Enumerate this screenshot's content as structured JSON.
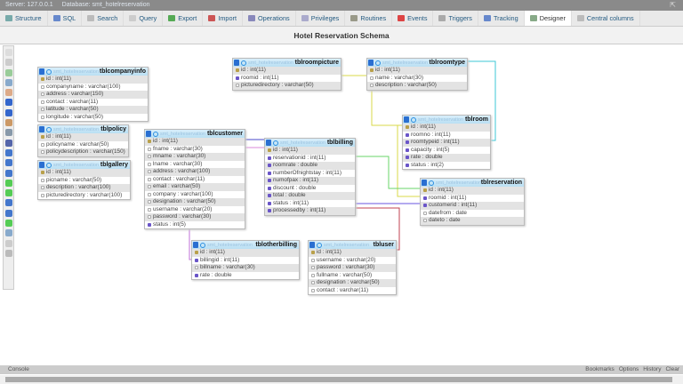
{
  "breadcrumb": {
    "server": "Server: 127.0.0.1",
    "database": "Database: smt_hotelreservation"
  },
  "tabs": [
    {
      "label": "Structure",
      "color": "#7aa"
    },
    {
      "label": "SQL",
      "color": "#68c"
    },
    {
      "label": "Search",
      "color": "#bbb"
    },
    {
      "label": "Query",
      "color": "#ccc"
    },
    {
      "label": "Export",
      "color": "#5a5"
    },
    {
      "label": "Import",
      "color": "#c55"
    },
    {
      "label": "Operations",
      "color": "#88b"
    },
    {
      "label": "Privileges",
      "color": "#aac"
    },
    {
      "label": "Routines",
      "color": "#998"
    },
    {
      "label": "Events",
      "color": "#d44"
    },
    {
      "label": "Triggers",
      "color": "#aaa"
    },
    {
      "label": "Tracking",
      "color": "#68c"
    },
    {
      "label": "Designer",
      "color": "#8a8",
      "active": true
    },
    {
      "label": "Central columns",
      "color": "#bbb"
    }
  ],
  "title": "Hotel Reservation Schema",
  "schema_prefix": "smt_hotelreservation",
  "tables": [
    {
      "name": "tblcompanyinfo",
      "fields": [
        [
          "pk",
          "id : int(11)"
        ],
        [
          "n",
          "companyname : varchar(100)"
        ],
        [
          "n",
          "address : varchar(150)"
        ],
        [
          "n",
          "contact : varchar(11)"
        ],
        [
          "n",
          "latitude : varchar(50)"
        ],
        [
          "n",
          "longitude : varchar(50)"
        ]
      ]
    },
    {
      "name": "tblpolicy",
      "fields": [
        [
          "pk",
          "id : int(11)"
        ],
        [
          "n",
          "policyname : varchar(50)"
        ],
        [
          "n",
          "policydescription : varchar(150)"
        ]
      ]
    },
    {
      "name": "tblgallery",
      "fields": [
        [
          "pk",
          "id : int(11)"
        ],
        [
          "n",
          "picname : varchar(50)"
        ],
        [
          "n",
          "description : varchar(100)"
        ],
        [
          "n",
          "picturedirectory : varchar(100)"
        ]
      ]
    },
    {
      "name": "tblcustomer",
      "fields": [
        [
          "pk",
          "id : int(11)"
        ],
        [
          "n",
          "fname : varchar(30)"
        ],
        [
          "n",
          "mname : varchar(30)"
        ],
        [
          "n",
          "lname : varchar(30)"
        ],
        [
          "n",
          "address : varchar(100)"
        ],
        [
          "n",
          "contact : varchar(11)"
        ],
        [
          "n",
          "email : varchar(50)"
        ],
        [
          "n",
          "company : varchar(100)"
        ],
        [
          "n",
          "designation : varchar(50)"
        ],
        [
          "n",
          "username : varchar(20)"
        ],
        [
          "n",
          "password : varchar(30)"
        ],
        [
          "fk",
          "status : int(5)"
        ]
      ]
    },
    {
      "name": "tblbilling",
      "fields": [
        [
          "pk",
          "id : int(11)"
        ],
        [
          "fk",
          "reservationid : int(11)"
        ],
        [
          "fk",
          "roomrate : double"
        ],
        [
          "fk",
          "numberOfnightstay : int(11)"
        ],
        [
          "fk",
          "numofpax : int(11)"
        ],
        [
          "fk",
          "discount : double"
        ],
        [
          "fk",
          "total : double"
        ],
        [
          "fk",
          "status : int(11)"
        ],
        [
          "fk",
          "processedby : int(11)"
        ]
      ]
    },
    {
      "name": "tblroompicture",
      "fields": [
        [
          "pk",
          "id : int(11)"
        ],
        [
          "fk",
          "roomid : int(11)"
        ],
        [
          "n",
          "picturedirectory : varchar(50)"
        ]
      ]
    },
    {
      "name": "tblroomtype",
      "fields": [
        [
          "pk",
          "id : int(11)"
        ],
        [
          "n",
          "name : varchar(30)"
        ],
        [
          "n",
          "description : varchar(50)"
        ]
      ]
    },
    {
      "name": "tblroom",
      "fields": [
        [
          "pk",
          "id : int(11)"
        ],
        [
          "fk",
          "roomno : int(11)"
        ],
        [
          "fk",
          "roomtypeid : int(11)"
        ],
        [
          "fk",
          "capacity : int(5)"
        ],
        [
          "fk",
          "rate : double"
        ],
        [
          "fk",
          "status : int(2)"
        ]
      ]
    },
    {
      "name": "tblreservation",
      "fields": [
        [
          "pk",
          "id : int(11)"
        ],
        [
          "fk",
          "roomid : int(11)"
        ],
        [
          "fk",
          "customerid : int(11)"
        ],
        [
          "n",
          "datefrom : date"
        ],
        [
          "n",
          "dateto : date"
        ]
      ]
    },
    {
      "name": "tblotherbilling",
      "fields": [
        [
          "pk",
          "id : int(11)"
        ],
        [
          "fk",
          "billingid : int(11)"
        ],
        [
          "n",
          "billname : varchar(30)"
        ],
        [
          "fk",
          "rate : double"
        ]
      ]
    },
    {
      "name": "tbluser",
      "fields": [
        [
          "pk",
          "id : int(11)"
        ],
        [
          "n",
          "username : varchar(20)"
        ],
        [
          "n",
          "password : varchar(30)"
        ],
        [
          "n",
          "fullname : varchar(50)"
        ],
        [
          "n",
          "designation : varchar(50)"
        ],
        [
          "n",
          "contact : varchar(11)"
        ]
      ]
    }
  ],
  "console": {
    "label": "Console",
    "bookmarks": "Bookmarks",
    "options": "Options",
    "history": "History",
    "clear": "Clear"
  }
}
